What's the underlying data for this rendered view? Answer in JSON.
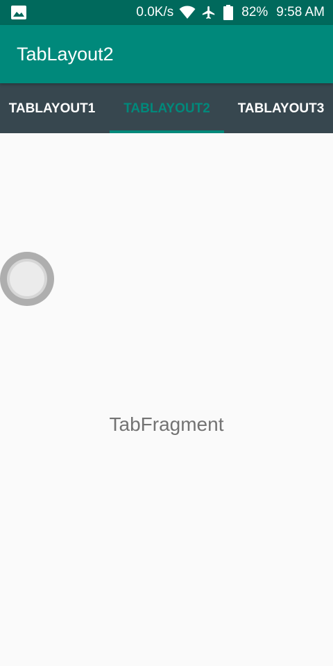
{
  "status_bar": {
    "network_speed": "0.0K/s",
    "battery_percent": "82%",
    "time": "9:58 AM",
    "icons": [
      "gallery-icon",
      "wifi-icon",
      "airplane-icon",
      "battery-icon"
    ]
  },
  "app_bar": {
    "title": "TabLayout2"
  },
  "tabs": [
    {
      "label": "TABLAYOUT1",
      "selected": false
    },
    {
      "label": "TABLAYOUT2",
      "selected": true
    },
    {
      "label": "TABLAYOUT3",
      "selected": false
    }
  ],
  "content": {
    "text": "TabFragment"
  },
  "colors": {
    "status_bar": "#00695c",
    "app_bar": "#00897b",
    "tab_bar": "#37474f",
    "accent": "#00897b",
    "background": "#fafafa"
  }
}
